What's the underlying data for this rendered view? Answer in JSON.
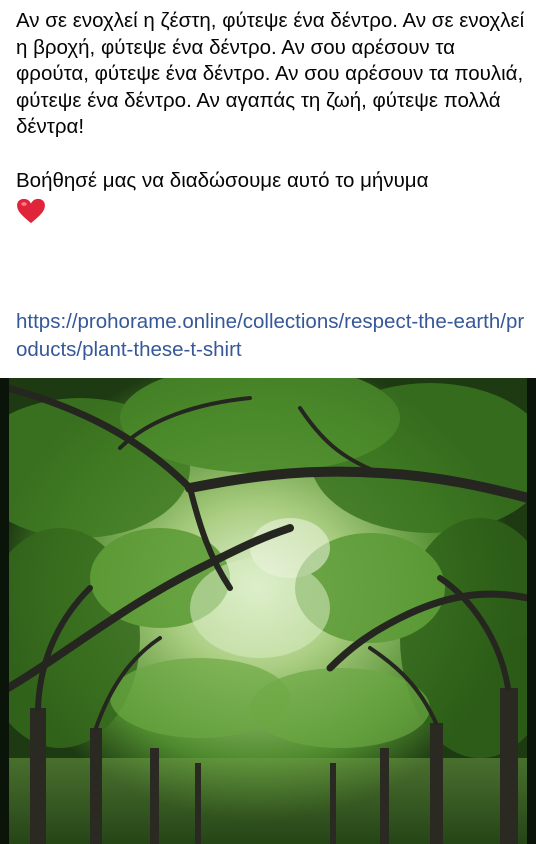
{
  "post": {
    "message": "Αν σε ενοχλεί η ζέστη, φύτεψε ένα δέντρο. Αν σε ενοχλεί η βροχή, φύτεψε ένα δέντρο. Αν σου αρέσουν τα φρούτα, φύτεψε ένα δέντρο. Αν σου αρέσουν τα πουλιά, φύτεψε ένα δέντρο. Αν αγαπάς τη ζωή, φύτεψε πολλά δέντρα!",
    "call_to_action": "Βοήθησέ μας να διαδώσουμε αυτό το μήνυμα",
    "emoji_icon": "red-heart-icon",
    "link": "https://prohorame.online/collections/respect-the-earth/products/plant-these-t-shirt"
  },
  "photo": {
    "subject_icon": "tree-canopy-photo",
    "colors": {
      "canopy": "#4f8a2e",
      "light": "#c9e2b0",
      "trunk": "#2a2a22",
      "dark": "#0e1a0a"
    }
  }
}
